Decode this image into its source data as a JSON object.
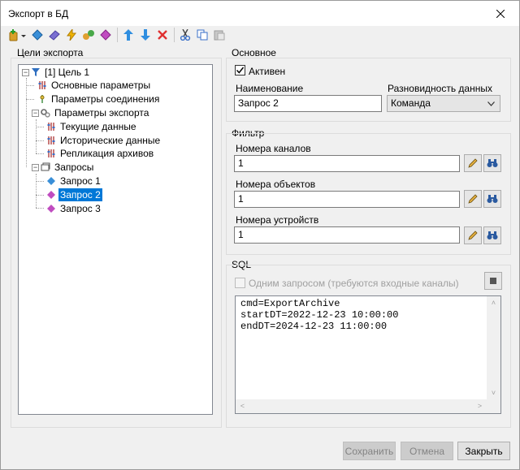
{
  "window": {
    "title": "Экспорт в БД"
  },
  "toolbar": {
    "buttons": [
      {
        "icon": "add-icon"
      },
      {
        "icon": "add-param-icon"
      },
      {
        "icon": "add-connection-icon"
      },
      {
        "icon": "add-export-icon"
      },
      {
        "icon": "add-replication-icon"
      },
      {
        "icon": "add-query-icon"
      },
      {
        "icon": "move-up-icon"
      },
      {
        "icon": "move-down-icon"
      },
      {
        "icon": "delete-icon"
      },
      {
        "icon": "cut-icon"
      },
      {
        "icon": "copy-icon"
      },
      {
        "icon": "paste-icon"
      }
    ]
  },
  "left_panel": {
    "title": "Цели экспорта",
    "tree": [
      {
        "label": "[1] Цель 1",
        "level": 0,
        "expanded": true
      },
      {
        "label": "Основные параметры",
        "level": 1
      },
      {
        "label": "Параметры соединения",
        "level": 1
      },
      {
        "label": "Параметры экспорта",
        "level": 1,
        "expanded": true
      },
      {
        "label": "Текущие данные",
        "level": 2
      },
      {
        "label": "Исторические данные",
        "level": 2
      },
      {
        "label": "Репликация архивов",
        "level": 2
      },
      {
        "label": "Запросы",
        "level": 1,
        "expanded": true
      },
      {
        "label": "Запрос 1",
        "level": 2
      },
      {
        "label": "Запрос 2",
        "level": 2,
        "selected": true
      },
      {
        "label": "Запрос 3",
        "level": 2
      }
    ]
  },
  "general": {
    "title": "Основное",
    "active_label": "Активен",
    "active_checked": true,
    "name_label": "Наименование",
    "name_value": "Запрос 2",
    "data_kind_label": "Разновидность данных",
    "data_kind_value": "Команда"
  },
  "filter": {
    "title": "Фильтр",
    "channels_label": "Номера каналов",
    "channels_value": "1",
    "objects_label": "Номера объектов",
    "objects_value": "1",
    "devices_label": "Номера устройств",
    "devices_value": "1"
  },
  "sql": {
    "title": "SQL",
    "single_query_label": "Одним запросом (требуются входные каналы)",
    "single_query_checked": false,
    "lines": [
      "cmd=ExportArchive",
      "startDT=2022-12-23 10:00:00",
      "endDT=2024-12-23 11:00:00"
    ]
  },
  "footer": {
    "save_label": "Сохранить",
    "cancel_label": "Отмена",
    "close_label": "Закрыть"
  },
  "colors": {
    "selection": "#0078d7",
    "window_bg": "#f0f0f0"
  }
}
